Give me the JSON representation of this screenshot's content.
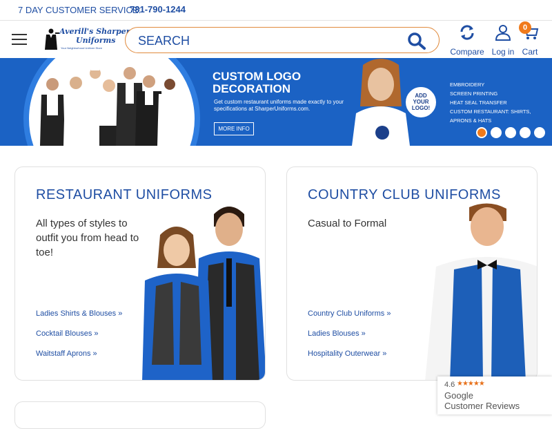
{
  "topbar": {
    "service_label": "7 DAY CUSTOMER SERVICE:",
    "phone": "781-790-1244"
  },
  "header": {
    "logo_line1": "Averill's Sharper",
    "logo_line2": "Uniforms",
    "logo_tagline": "Your Neighborhood Uniform Store",
    "search_placeholder": "SEARCH",
    "compare_label": "Compare",
    "login_label": "Log in",
    "cart_label": "Cart",
    "cart_count": "0"
  },
  "banner": {
    "title_line1": "CUSTOM LOGO",
    "title_line2": "DECORATION",
    "description": "Get custom restaurant uniforms made exactly to your specifications at SharperUniforms.com.",
    "button_label": "MORE INFO",
    "add_logo_line1": "ADD",
    "add_logo_line2": "YOUR",
    "add_logo_line3": "LOGO!",
    "services": [
      "EMBROIDERY",
      "SCREEN PRINTING",
      "HEAT SEAL TRANSFER",
      "CUSTOM RESTAURANT: SHIRTS,",
      "APRONS & HATS"
    ],
    "slides": 5,
    "active_slide": 1
  },
  "cards": [
    {
      "title": "RESTAURANT UNIFORMS",
      "subtitle_lines": [
        "All types of styles to",
        "outfit you from head to",
        "toe!"
      ],
      "links": [
        "Ladies Shirts & Blouses »",
        "Cocktail Blouses »",
        "Waitstaff Aprons »"
      ]
    },
    {
      "title": "COUNTRY CLUB UNIFORMS",
      "subtitle_lines": [
        "Casual to Formal"
      ],
      "links": [
        "Country Club Uniforms »",
        "Ladies Blouses »",
        "Hospitality Outerwear »"
      ]
    }
  ],
  "reviews": {
    "rating": "4.6",
    "stars": "★★★★★",
    "line1": "Google",
    "line2": "Customer Reviews"
  },
  "colors": {
    "brand_blue": "#1f4ea3",
    "banner_blue": "#1b62c4",
    "accent_orange": "#f07a1a"
  }
}
